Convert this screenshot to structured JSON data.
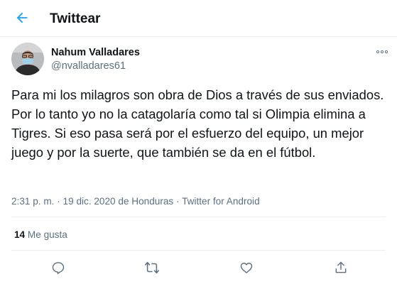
{
  "header": {
    "title": "Twittear",
    "back_icon": "arrow-left-icon"
  },
  "author": {
    "name": "Nahum Valladares",
    "handle": "@nvalladares61",
    "avatar_icon": "avatar"
  },
  "tweet": {
    "text": "Para mi los milagros son obra de Dios a través de sus enviados. Por lo tanto yo no la catagolaría como tal si Olimpia elimina a Tigres. Si eso pasa será por el esfuerzo del equipo, un mejor juego y por la suerte, que también se da en el fútbol.",
    "time": "2:31 p. m.",
    "date": "19 dic. 2020 de Honduras",
    "source": "Twitter for Android",
    "separator": "·"
  },
  "stats": {
    "likes_count": "14",
    "likes_label": "Me gusta"
  },
  "actions": [
    "reply-icon",
    "retweet-icon",
    "like-icon",
    "share-icon"
  ],
  "colors": {
    "accent": "#1da1f2",
    "secondary_text": "#5b7083",
    "divider": "#ebeef0"
  }
}
